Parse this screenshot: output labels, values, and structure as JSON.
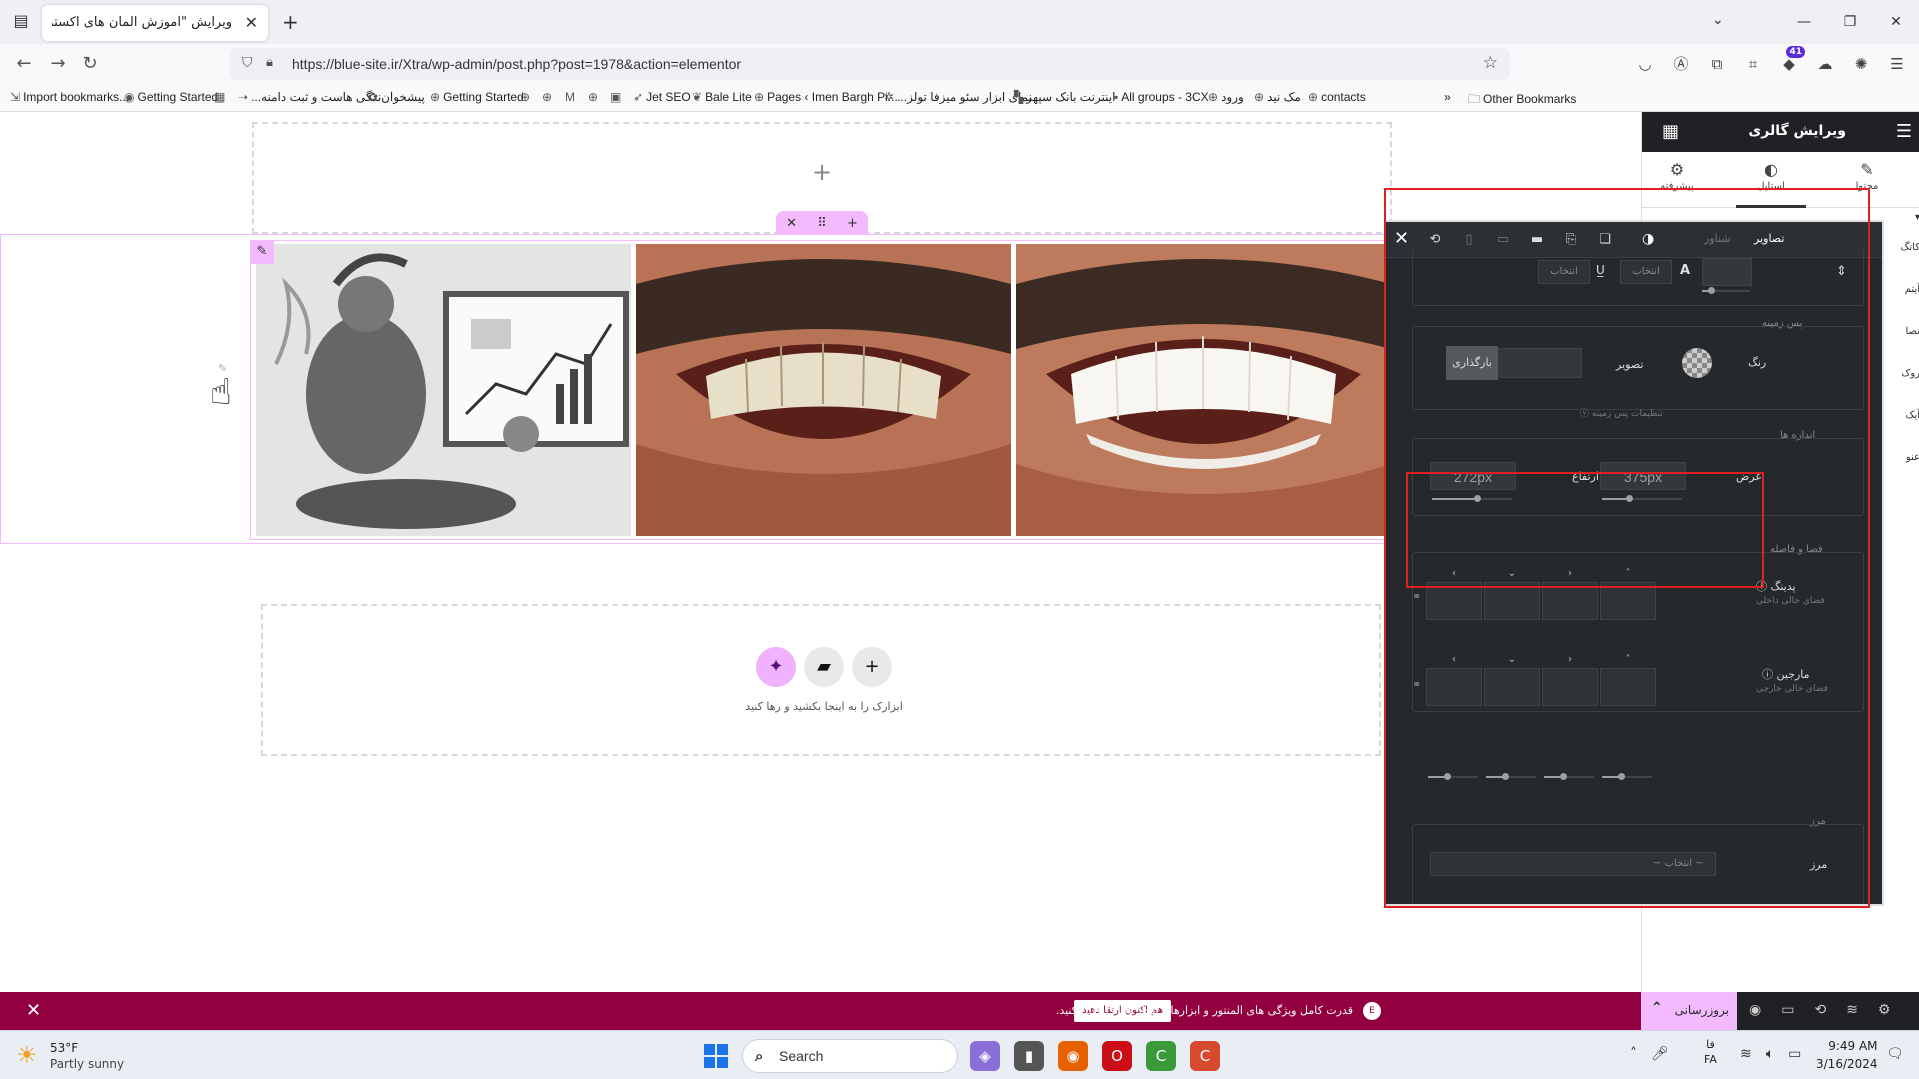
{
  "browser": {
    "tab_title": "ویرایش \"آموزش المان های اکسترا – ‌",
    "url": "https://blue-site.ir/Xtra/wp-admin/post.php?post=1978&action=elementor",
    "extension_badge": "41",
    "bookmarks": [
      "Import bookmarks...",
      "Getting Started",
      "...ندگی هاست و ثبت دامنه",
      "پیشخوان",
      "Getting Started",
      "Jet SEO",
      "Bale Lite",
      "Pages ‹ Imen Bargh Pi...",
      "...نمای ابزار سئو میزفا تولز",
      "اینترنت بانک سپهر",
      "All groups - 3CX",
      "ورود",
      "مک نید",
      "contacts"
    ],
    "other_bookmarks": "Other Bookmarks"
  },
  "canvas": {
    "drop_text": "ابزارک را به اینجا بکشید و رها کنید"
  },
  "panel": {
    "title": "ویرایش گالری",
    "tabs": {
      "content": "محتوا",
      "style": "استایل",
      "advanced": "پیشرفته"
    },
    "side_labels": [
      "کاتگ",
      "آیتم",
      "تصا",
      "روک",
      "آیک",
      "عنو"
    ]
  },
  "popup": {
    "tab_images": "تصاویر",
    "tab_overlay": "شناور",
    "typography": {
      "select1": "انتخاب",
      "select2": "انتخاب"
    },
    "background": {
      "title": "پس زمینه",
      "color_label": "رنگ",
      "image_label": "تصویر",
      "upload": "بارگذاری",
      "settings": "تنظیمات پس زمینه"
    },
    "dimensions": {
      "title": "اندازه ها",
      "width_label": "عرض",
      "height_label": "ارتفاع",
      "width_value": "375px",
      "height_value": "272px"
    },
    "spacing": {
      "title": "فضا و فاصله",
      "padding_label": "پدینگ",
      "padding_sub": "فضای خالی داخلی",
      "margin_label": "مارجین",
      "margin_sub": "فضای خالی خارجی"
    },
    "border": {
      "title": "مرز",
      "label": "مرز",
      "select": "~ انتخاب ~"
    }
  },
  "notice": {
    "text": "قدرت کامل ویژگی های المنتور و ابزارهای ایجاد وب را فعال کنید.",
    "button": "هم اکنون ارتقا دهید"
  },
  "footer": {
    "publish": "بروزرسانی"
  },
  "taskbar": {
    "temp": "53°F",
    "weather": "Partly sunny",
    "search": "Search",
    "lang1": "فا",
    "lang2": "FA",
    "time": "9:49 AM",
    "date": "3/16/2024"
  },
  "colors": {
    "accent_pink": "#f3bafd",
    "notice_bg": "#93003f",
    "panel_dark": "#26292c",
    "highlight_red": "#e02020"
  }
}
